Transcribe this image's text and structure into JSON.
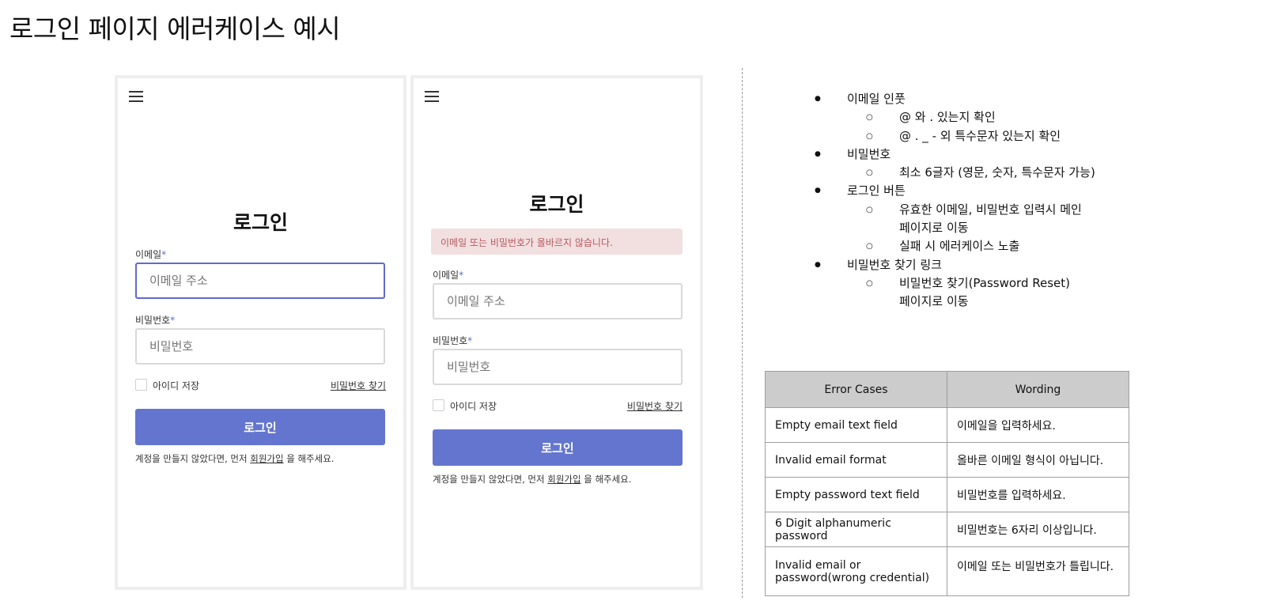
{
  "page": {
    "title": "로그인 페이지 에러케이스 예시"
  },
  "login_form": {
    "title": "로그인",
    "email_label": "이메일",
    "password_label": "비밀번호",
    "required_mark": "*",
    "email_placeholder": "이메일 주소",
    "password_placeholder": "비밀번호",
    "remember_label": "아이디 저장",
    "find_password": "비밀번호 찾기",
    "submit": "로그인",
    "signup_prefix": "계정을 만들지 않았다면, 먼저 ",
    "signup_link": "회원가입",
    "signup_suffix": " 을 해주세요.",
    "error_message": "이메일 또는 비밀번호가 올바르지 않습니다."
  },
  "notes": [
    {
      "level": 1,
      "text": "이메일 인풋"
    },
    {
      "level": 2,
      "text": "@ 와 . 있는지 확인"
    },
    {
      "level": 2,
      "text": "@ . _ - 외 특수문자 있는지 확인"
    },
    {
      "level": 1,
      "text": "비밀번호"
    },
    {
      "level": 2,
      "text": "최소 6글자 (영문, 숫자, 특수문자 가능)"
    },
    {
      "level": 1,
      "text": "로그인 버튼"
    },
    {
      "level": 2,
      "text": "유효한 이메일, 비밀번호 입력시 메인"
    },
    {
      "level": 3,
      "text": "페이지로 이동"
    },
    {
      "level": 2,
      "text": "실패 시 에러케이스 노출"
    },
    {
      "level": 1,
      "text": "비밀번호 찾기 링크"
    },
    {
      "level": 2,
      "text": "비밀번호 찾기(Password Reset)"
    },
    {
      "level": 3,
      "text": "페이지로 이동"
    }
  ],
  "error_table": {
    "headers": [
      "Error Cases",
      "Wording"
    ],
    "rows": [
      [
        "Empty email text field",
        "이메일을 입력하세요."
      ],
      [
        "Invalid email format",
        "올바른 이메일 형식이 아닙니다."
      ],
      [
        "Empty password text field",
        "비밀번호를 입력하세요."
      ],
      [
        "6 Digit alphanumeric password",
        "비밀번호는 6자리 이상입니다."
      ],
      [
        "Invalid email or password(wrong credential)",
        "이메일 또는 비밀번호가 틀립니다."
      ]
    ]
  },
  "colors": {
    "primary": "#6475cf",
    "focus_border": "#5e6bcf",
    "error_bg": "#f2dfe0",
    "error_text": "#b5595f",
    "table_header_bg": "#cccccc"
  }
}
